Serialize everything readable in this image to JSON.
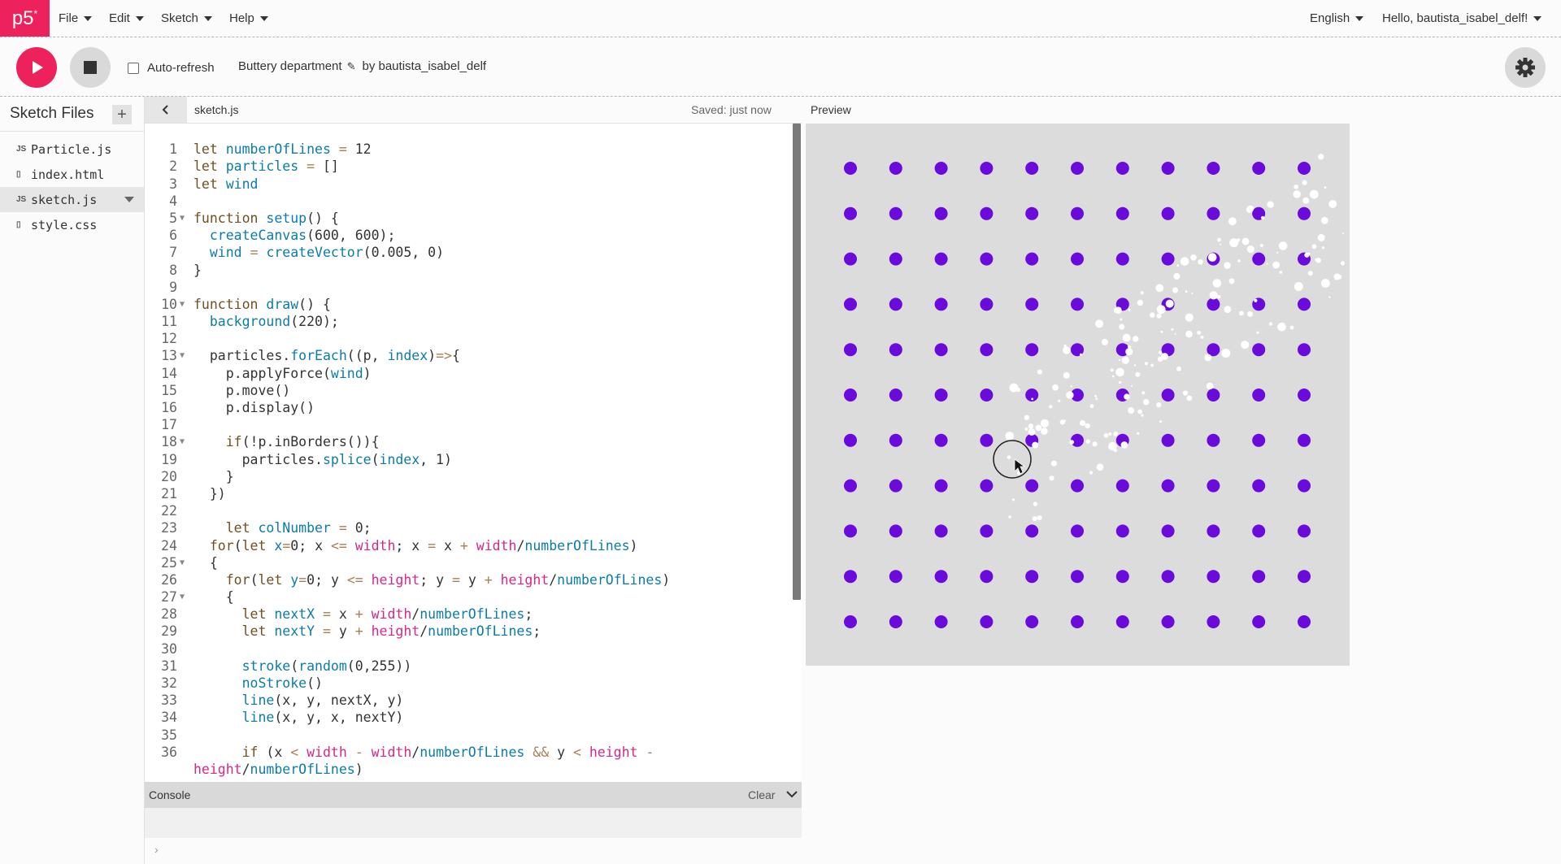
{
  "nav": {
    "logo": "p5",
    "logo_sup": "*",
    "menus": [
      "File",
      "Edit",
      "Sketch",
      "Help"
    ],
    "language": "English",
    "user": "Hello, bautista_isabel_delf!"
  },
  "toolbar": {
    "autorefresh_label": "Auto-refresh",
    "autorefresh_checked": false,
    "sketch_title": "Buttery department",
    "author": "by bautista_isabel_delf"
  },
  "sidebar": {
    "title": "Sketch Files",
    "files": [
      {
        "name": "Particle.js",
        "type": "JS",
        "active": false
      },
      {
        "name": "index.html",
        "type": "html",
        "active": false
      },
      {
        "name": "sketch.js",
        "type": "JS",
        "active": true
      },
      {
        "name": "style.css",
        "type": "css",
        "active": false
      }
    ]
  },
  "editor": {
    "file_name": "sketch.js",
    "saved_status": "Saved: just now",
    "first_line_number": 1,
    "fold_lines": [
      5,
      10,
      13,
      18,
      25,
      27
    ],
    "code_lines": [
      "",
      "let numberOfLines = 12",
      "let particles = []",
      "let wind",
      "",
      "function setup() {",
      "  createCanvas(600, 600);",
      "  wind = createVector(0.005, 0)",
      "}",
      "",
      "function draw() {",
      "  background(220);",
      "",
      "  particles.forEach((p, index)=>{",
      "    p.applyForce(wind)",
      "    p.move()",
      "    p.display()",
      "",
      "    if(!p.inBorders()){",
      "      particles.splice(index, 1)",
      "    }",
      "  })",
      "",
      "    let colNumber = 0;",
      "  for(let x=0; x <= width; x = x + width/numberOfLines)",
      "  {",
      "    for(let y=0; y <= height; y = y + height/numberOfLines)",
      "    {",
      "      let nextX = x + width/numberOfLines;",
      "      let nextY = y + height/numberOfLines;",
      "",
      "      stroke(random(0,255))",
      "      noStroke()",
      "      line(x, y, nextX, y)",
      "      line(x, y, x, nextY)",
      "",
      "      if (x < width - width/numberOfLines && y < height -",
      "height/numberOfLines)"
    ]
  },
  "console": {
    "title": "Console",
    "clear_label": "Clear",
    "prompt": "›"
  },
  "preview": {
    "label": "Preview",
    "background": "#dcdcdc",
    "dot_color": "#6a0bdc",
    "particle_color": "#ffffff",
    "grid_rows": 11,
    "grid_cols": 11
  },
  "colors": {
    "brand": "#ed225d",
    "keyword": "#704f21",
    "function": "#0b7ca9",
    "builtin": "#d52889"
  }
}
